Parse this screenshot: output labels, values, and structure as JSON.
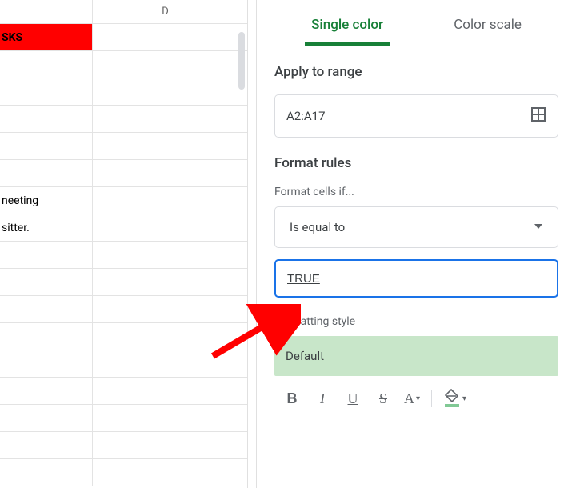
{
  "sheet": {
    "col_headers": [
      "",
      "D"
    ],
    "rows": [
      {
        "c0": "SKS",
        "c1": "",
        "hdr": true
      },
      {
        "c0": "",
        "c1": ""
      },
      {
        "c0": "",
        "c1": ""
      },
      {
        "c0": "",
        "c1": ""
      },
      {
        "c0": "",
        "c1": ""
      },
      {
        "c0": "",
        "c1": ""
      },
      {
        "c0": "neeting",
        "c1": ""
      },
      {
        "c0": "sitter.",
        "c1": ""
      },
      {
        "c0": "",
        "c1": ""
      },
      {
        "c0": "",
        "c1": ""
      },
      {
        "c0": "",
        "c1": ""
      },
      {
        "c0": "",
        "c1": ""
      },
      {
        "c0": "",
        "c1": ""
      },
      {
        "c0": "",
        "c1": ""
      },
      {
        "c0": "",
        "c1": ""
      },
      {
        "c0": "",
        "c1": ""
      },
      {
        "c0": "",
        "c1": ""
      }
    ]
  },
  "panel": {
    "tabs": {
      "single": "Single color",
      "scale": "Color scale"
    },
    "apply_label": "Apply to range",
    "range": "A2:A17",
    "format_rules_label": "Format rules",
    "format_if_label": "Format cells if...",
    "condition": "Is equal to",
    "value": "TRUE",
    "style_label": "Formatting style",
    "style_name": "Default",
    "toolbar": {
      "bold": "B",
      "italic": "I",
      "underline": "U",
      "strike": "S",
      "textcolor": "A",
      "fill": "fill"
    }
  }
}
